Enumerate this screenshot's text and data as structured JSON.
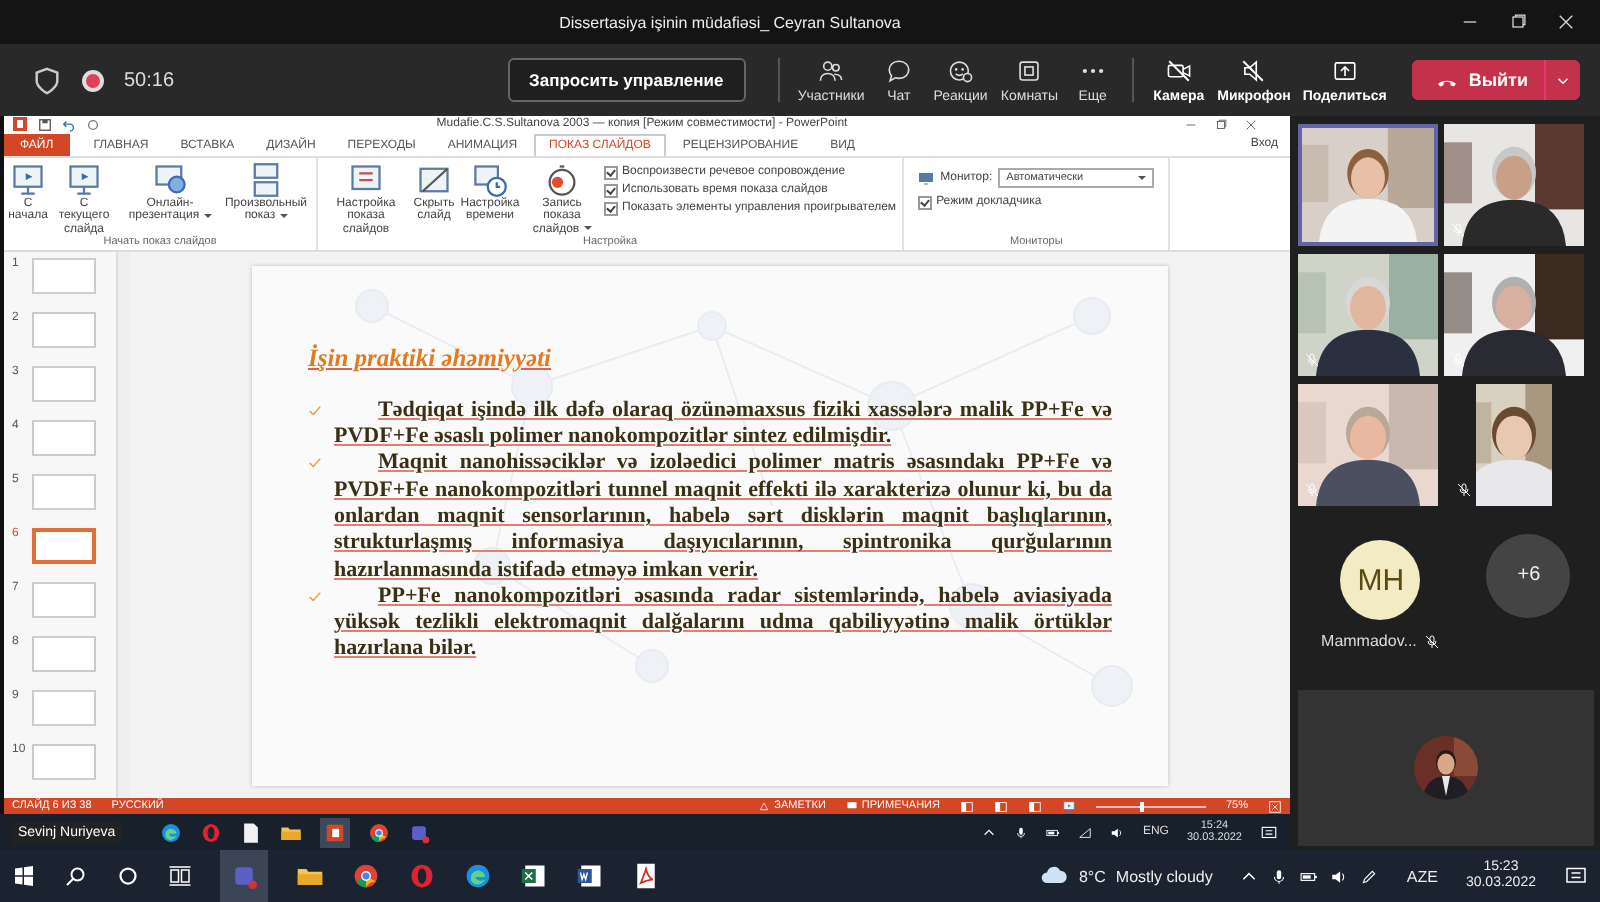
{
  "meeting": {
    "title": "Dissertasiya işinin müdafiəsi_ Ceyran Sultanova",
    "recording": true,
    "timer": "50:16",
    "request_control": "Запросить управление",
    "actions": [
      {
        "kind": "people",
        "label": "Участники"
      },
      {
        "kind": "chat",
        "label": "Чат"
      },
      {
        "kind": "reaction",
        "label": "Реакции"
      },
      {
        "kind": "rooms",
        "label": "Комнаты"
      },
      {
        "kind": "more",
        "label": "Еще"
      }
    ],
    "devices": [
      {
        "kind": "camera",
        "label": "Камера",
        "off": true
      },
      {
        "kind": "mic",
        "label": "Микрофон",
        "off": true
      },
      {
        "kind": "share",
        "label": "Поделиться",
        "off": false
      }
    ],
    "leave": "Выйти"
  },
  "powerpoint": {
    "title": "Mudafie.C.S.Sultanova 2003 — копия [Режим совместимости] - PowerPoint",
    "sign_in": "Вход",
    "tabs": [
      {
        "kind": "file",
        "label": "ФАЙЛ",
        "selected": false
      },
      {
        "kind": "tab",
        "label": "ГЛАВНАЯ",
        "selected": false
      },
      {
        "kind": "tab",
        "label": "ВСТАВКА",
        "selected": false
      },
      {
        "kind": "tab",
        "label": "ДИЗАЙН",
        "selected": false
      },
      {
        "kind": "tab",
        "label": "ПЕРЕХОДЫ",
        "selected": false
      },
      {
        "kind": "tab",
        "label": "АНИМАЦИЯ",
        "selected": false
      },
      {
        "kind": "tab",
        "label": "ПОКАЗ СЛАЙДОВ",
        "selected": true
      },
      {
        "kind": "tab",
        "label": "РЕЦЕНЗИРОВАНИЕ",
        "selected": false
      },
      {
        "kind": "tab",
        "label": "ВИД",
        "selected": false
      }
    ],
    "ribbon_groups": [
      {
        "title": "Начать показ слайдов",
        "items": [
          {
            "kind": "button",
            "label": "С начала",
            "dropdown": false
          },
          {
            "kind": "button",
            "label": "С текущего слайда",
            "dropdown": false
          },
          {
            "kind": "button",
            "label": "Онлайн-презентация",
            "dropdown": true
          },
          {
            "kind": "button",
            "label": "Произвольный показ",
            "dropdown": true
          }
        ]
      },
      {
        "title": "Настройка",
        "items": [
          {
            "kind": "button",
            "label": "Настройка показа слайдов",
            "dropdown": false
          },
          {
            "kind": "button",
            "label": "Скрыть слайд",
            "dropdown": false
          },
          {
            "kind": "button",
            "label": "Настройка времени",
            "dropdown": false
          },
          {
            "kind": "button",
            "label": "Запись показа слайдов",
            "dropdown": true
          },
          {
            "kind": "checkbox",
            "label": "Воспроизвести речевое сопровождение",
            "checked": true
          },
          {
            "kind": "checkbox",
            "label": "Использовать время показа слайдов",
            "checked": true
          },
          {
            "kind": "checkbox",
            "label": "Показать элементы управления проигрывателем",
            "checked": true
          }
        ]
      },
      {
        "title": "Мониторы",
        "items": [
          {
            "kind": "select",
            "label": "Монитор:",
            "value": "Автоматически"
          },
          {
            "kind": "checkbox",
            "label": "Режим докладчика",
            "checked": true
          }
        ]
      }
    ],
    "thumbnails": [
      {
        "number": "1",
        "selected": false
      },
      {
        "number": "2",
        "selected": false
      },
      {
        "number": "3",
        "selected": false
      },
      {
        "number": "4",
        "selected": false
      },
      {
        "number": "5",
        "selected": false
      },
      {
        "number": "6",
        "selected": true
      },
      {
        "number": "7",
        "selected": false
      },
      {
        "number": "8",
        "selected": false
      },
      {
        "number": "9",
        "selected": false
      },
      {
        "number": "10",
        "selected": false
      }
    ],
    "slide": {
      "heading": "İşin praktiki əhəmiyyəti",
      "bullets": [
        "Tədqiqat işində ilk dəfə olaraq özünəmaxsus fiziki xassələrə malik PP+Fe və PVDF+Fe əsaslı polimer nanokompozitlər sintez edilmişdir.",
        "Maqnit nanohissəciklər və izoləedici polimer matris əsasındakı PP+Fe və PVDF+Fe nanokompozitləri tunnel maqnit effekti ilə xarakterizə olunur ki, bu da onlardan maqnit sensorlarının, habelə sərt disklərin maqnit başlıqlarının, strukturlaşmış informasiya daşıyıcılarının, spintronika qurğularının hazırlanmasında istifadə etməyə imkan verir.",
        "PP+Fe nanokompozitləri əsasında radar sistemlərində, habelə aviasiyada yüksək tezlikli elektromaqnit dalğalarını udma qabiliyyətinə malik örtüklər hazırlana bilər."
      ]
    },
    "status_bar": {
      "slide_counter": "СЛАЙД 6 ИЗ 38",
      "language": "РУССКИЙ",
      "notes": "ЗАМЕТКИ",
      "comments": "ПРИМЕЧАНИЯ",
      "zoom": "75%",
      "level": 0.4
    }
  },
  "remote_desktop": {
    "presenter": "Sevinj Nuriyeva",
    "language": "ENG",
    "time": "15:24",
    "date": "30.03.2022"
  },
  "participants": {
    "tiles": [
      {
        "kind": "video",
        "selected": true,
        "muted": false
      },
      {
        "kind": "video",
        "selected": false,
        "muted": true
      },
      {
        "kind": "video",
        "selected": false,
        "muted": true
      },
      {
        "kind": "video",
        "selected": false,
        "muted": true
      },
      {
        "kind": "video",
        "selected": false,
        "muted": true
      },
      {
        "kind": "portrait",
        "selected": false,
        "muted": true
      }
    ],
    "avatar": {
      "initials": "MH",
      "name": "Mammadov...",
      "muted": true
    },
    "overflow": "+6"
  },
  "taskbar": {
    "temperature": "8°C",
    "weather": "Mostly cloudy",
    "language": "AZE",
    "time": "15:23",
    "date": "30.03.2022"
  }
}
